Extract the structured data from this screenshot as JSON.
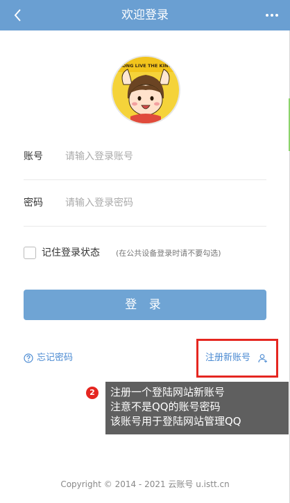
{
  "header": {
    "title": "欢迎登录"
  },
  "form": {
    "account_label": "账号",
    "account_placeholder": "请输入登录账号",
    "password_label": "密码",
    "password_placeholder": "请输入登录密码",
    "remember_label": "记住登录状态",
    "remember_hint": "(在公共设备登录时请不要勾选)",
    "login_label": "登 录"
  },
  "links": {
    "forgot": "忘记密码",
    "register": "注册新账号"
  },
  "annotation": {
    "badge": "2",
    "lines": [
      "注册一个登陆网站新账号",
      "注意不是QQ的账号密码",
      "该账号用于登陆网站管理QQ"
    ]
  },
  "footer": {
    "copyright": "Copyright © 2014 - 2021 云账号 u.istt.cn"
  },
  "avatar": {
    "banner_text": "LONG LIVE THE KING"
  },
  "colors": {
    "header": "#6a9fd2",
    "button": "#6fa4d4",
    "link": "#4a8ad2",
    "highlight": "#e52620"
  },
  "icons": {
    "back": "chevron-left-icon",
    "more": "more-icon",
    "forgot": "help-circle-icon",
    "register": "add-user-icon"
  }
}
